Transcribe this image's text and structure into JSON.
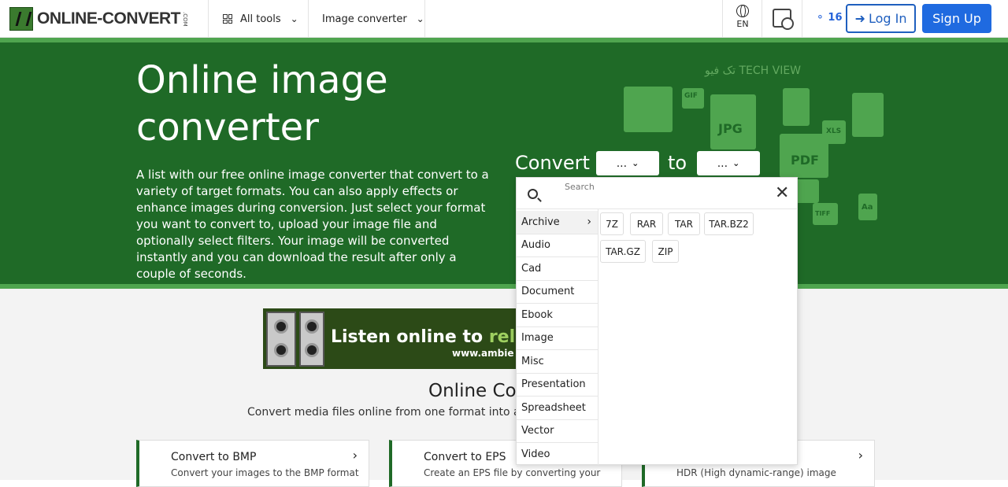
{
  "header": {
    "logo_text": "ONLINE-CONVERT",
    "logo_suffix": ".COM",
    "all_tools": "All tools",
    "image_converter": "Image converter",
    "lang": "EN",
    "credits": "16",
    "login": "Log In",
    "signup": "Sign Up"
  },
  "hero": {
    "title": "Online image converter",
    "description": "A list with our free online image converter that convert to a variety of target formats. You can also apply effects or enhance images during conversion. Just select your format you want to convert to, upload your image file and optionally select filters. Your image will be converted instantly and you can download the result after only a couple of seconds.",
    "convert_label": "Convert",
    "to_label": "to",
    "from_select": "...",
    "to_select": "...",
    "deco_icons": [
      "GIF",
      "JPG",
      "PDF",
      "XLS",
      "TIFF",
      "Aa"
    ],
    "watermark": "تک فیو TECH VIEW"
  },
  "dropdown": {
    "search_placeholder": "Search",
    "categories": [
      "Archive",
      "Audio",
      "Cad",
      "Document",
      "Ebook",
      "Image",
      "Misc",
      "Presentation",
      "Spreadsheet",
      "Vector",
      "Video"
    ],
    "active_category": "Archive",
    "formats": [
      "7Z",
      "RAR",
      "TAR",
      "TAR.BZ2",
      "TAR.GZ",
      "ZIP"
    ]
  },
  "banner": {
    "line1_a": "Listen online to ",
    "line1_b": "relax",
    "line2": "www.ambie"
  },
  "section": {
    "title": "Online Co",
    "subtitle": "Convert media files online from one format into a"
  },
  "cards": [
    {
      "title": "Convert to BMP",
      "desc": "Convert your images to the BMP format"
    },
    {
      "title": "Convert to EPS",
      "desc": "Create an EPS file by converting your"
    },
    {
      "title": "",
      "desc": "HDR (High dynamic-range) image"
    }
  ],
  "colors": {
    "hero_green": "#1f6a27",
    "accent_green": "#4fa54f",
    "primary_blue": "#1f6ae0"
  }
}
